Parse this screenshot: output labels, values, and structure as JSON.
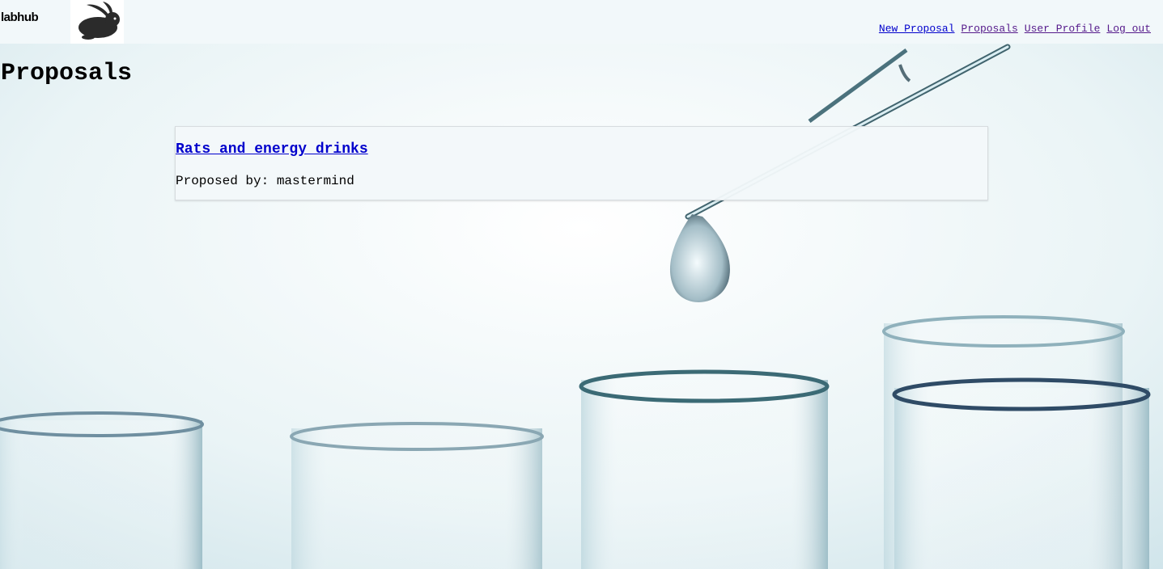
{
  "navbar": {
    "brand": "labhub",
    "logo_icon": "rabbit-logo-icon",
    "links": [
      {
        "label": "New Proposal"
      },
      {
        "label": "Proposals"
      },
      {
        "label": "User Profile"
      },
      {
        "label": "Log out"
      }
    ]
  },
  "page": {
    "title": "Proposals"
  },
  "proposals": [
    {
      "title": "Rats and energy drinks",
      "proposed_by_label": "Proposed by:",
      "author": "mastermind"
    }
  ],
  "colors": {
    "link": "#0000cc",
    "visited_link": "#551a8b",
    "navbar_bg": "#f2f8fa",
    "card_bg": "#f2f8fa"
  }
}
